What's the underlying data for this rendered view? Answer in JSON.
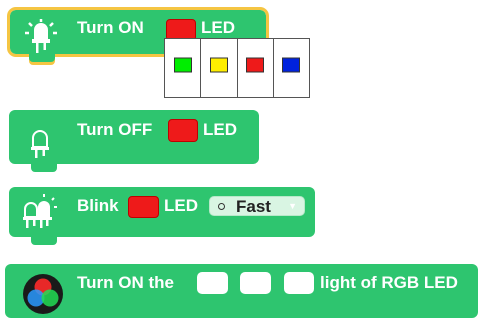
{
  "blocks": {
    "turn_on": {
      "prefix": "Turn ON",
      "suffix": "LED",
      "icon": "led-bulb-on-icon",
      "selected_color": "#ee1a1a"
    },
    "color_picker": {
      "options": [
        {
          "name": "green",
          "color": "#00ee00"
        },
        {
          "name": "yellow",
          "color": "#ffee00"
        },
        {
          "name": "red",
          "color": "#ee1a1a"
        },
        {
          "name": "blue",
          "color": "#0022dd"
        }
      ]
    },
    "turn_off": {
      "prefix": "Turn OFF",
      "suffix": "LED",
      "icon": "led-bulb-off-icon",
      "selected_color": "#ee1a1a"
    },
    "blink": {
      "prefix": "Blink",
      "middle": "LED",
      "speed_value": "Fast",
      "icon": "led-blink-icon",
      "selected_color": "#ee1a1a"
    },
    "rgb": {
      "prefix": "Turn ON the",
      "suffix": "light of RGB LED",
      "icon": "rgb-led-icon"
    }
  },
  "colors": {
    "block_green": "#2ec56f",
    "highlight": "#f5c542"
  }
}
